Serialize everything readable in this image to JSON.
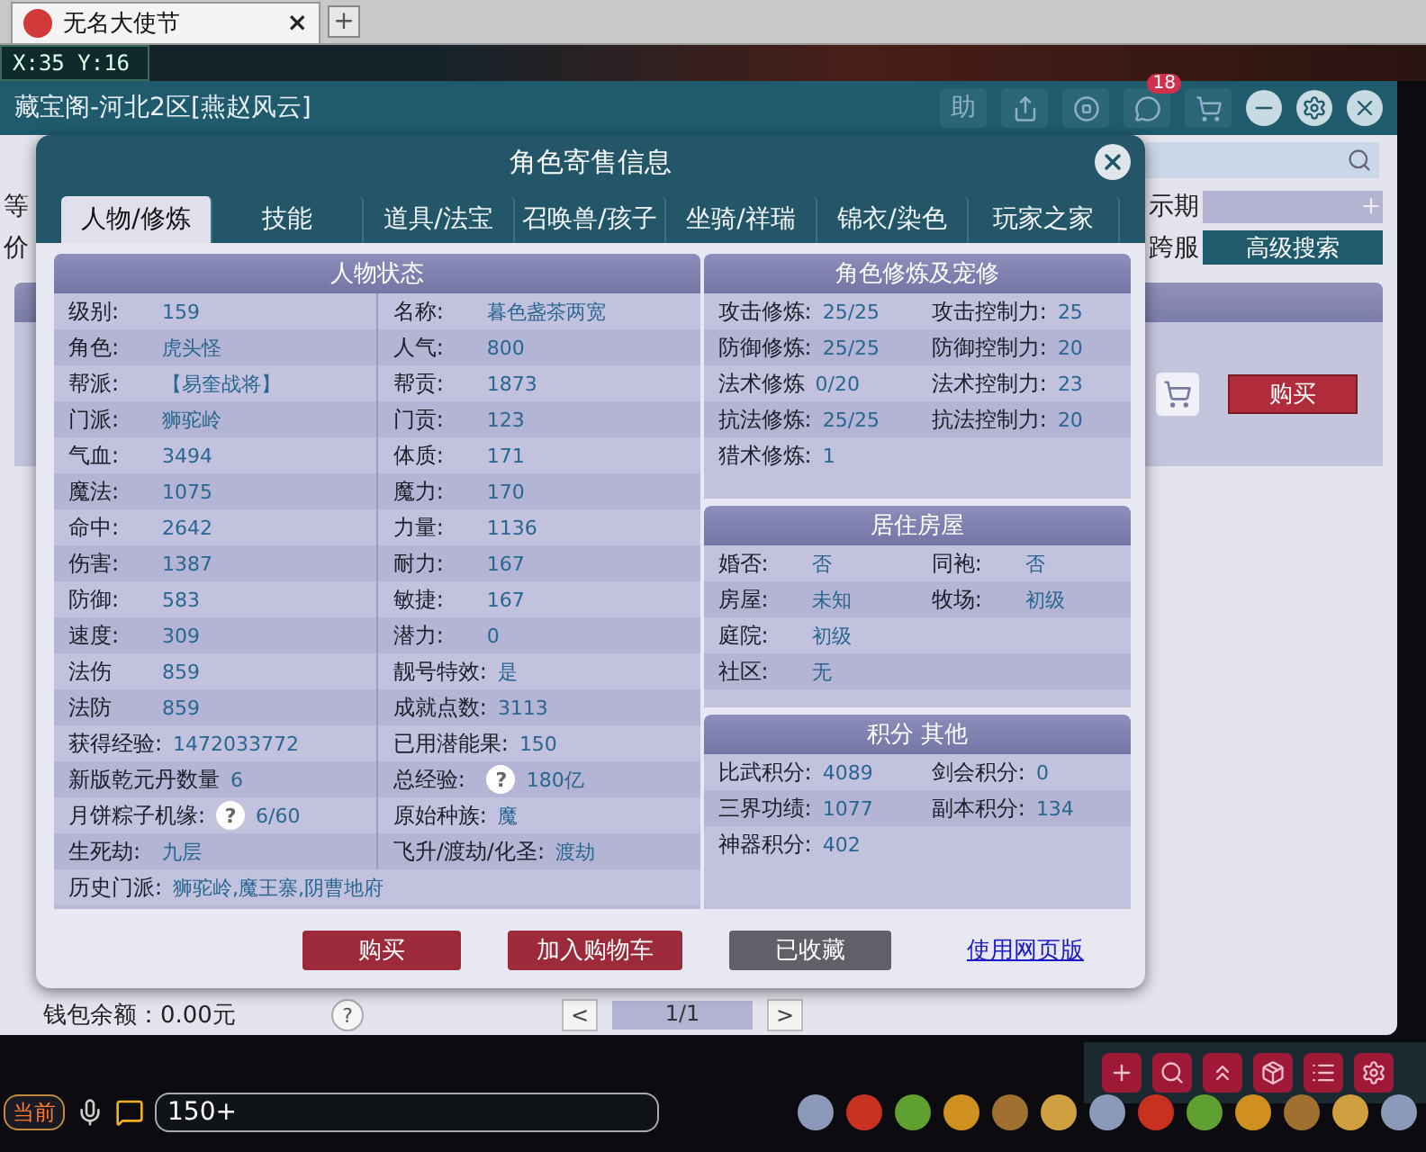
{
  "browser": {
    "tab_title": "无名大使节",
    "tab_close": "×",
    "new_tab": "+"
  },
  "game_hud": {
    "coords": "X:35 Y:16"
  },
  "back_window": {
    "title": "藏宝阁-河北2区[燕赵风云]",
    "help_button": "助",
    "notification_count": "18",
    "left_labels": [
      "等",
      "价"
    ],
    "right_labels": [
      "示期",
      "跨服"
    ],
    "advanced_search": "高级搜索",
    "buy": "购买",
    "wallet": "钱包余额：0.00元",
    "help_mark": "?",
    "pager": {
      "prev": "<",
      "page": "1/1",
      "next": ">"
    }
  },
  "dialog": {
    "title": "角色寄售信息",
    "tabs": [
      {
        "label": "人物/修炼",
        "selected": true
      },
      {
        "label": "技能",
        "selected": false
      },
      {
        "label": "道具/法宝",
        "selected": false
      },
      {
        "label": "召唤兽/孩子",
        "selected": false
      },
      {
        "label": "坐骑/祥瑞",
        "selected": false
      },
      {
        "label": "锦衣/染色",
        "selected": false
      },
      {
        "label": "玩家之家",
        "selected": false
      }
    ],
    "status_panel": {
      "title": "人物状态",
      "rows": [
        [
          {
            "label": "级别:",
            "value": "159"
          },
          {
            "label": "名称:",
            "value": "暮色盏茶两宽"
          }
        ],
        [
          {
            "label": "角色:",
            "value": "虎头怪"
          },
          {
            "label": "人气:",
            "value": "800"
          }
        ],
        [
          {
            "label": "帮派:",
            "value": "【易奎战将】"
          },
          {
            "label": "帮贡:",
            "value": "1873"
          }
        ],
        [
          {
            "label": "门派:",
            "value": "狮驼岭"
          },
          {
            "label": "门贡:",
            "value": "123"
          }
        ],
        [
          {
            "label": "气血:",
            "value": "3494"
          },
          {
            "label": "体质:",
            "value": "171"
          }
        ],
        [
          {
            "label": "魔法:",
            "value": "1075"
          },
          {
            "label": "魔力:",
            "value": "170"
          }
        ],
        [
          {
            "label": "命中:",
            "value": "2642"
          },
          {
            "label": "力量:",
            "value": "1136"
          }
        ],
        [
          {
            "label": "伤害:",
            "value": "1387"
          },
          {
            "label": "耐力:",
            "value": "167"
          }
        ],
        [
          {
            "label": "防御:",
            "value": "583"
          },
          {
            "label": "敏捷:",
            "value": "167"
          }
        ],
        [
          {
            "label": "速度:",
            "value": "309"
          },
          {
            "label": "潜力:",
            "value": "0"
          }
        ],
        [
          {
            "label": "法伤",
            "value": "859"
          },
          {
            "label": "靓号特效:",
            "value": "是"
          }
        ],
        [
          {
            "label": "法防",
            "value": "859"
          },
          {
            "label": "成就点数:",
            "value": "3113"
          }
        ],
        [
          {
            "label": "获得经验:",
            "value": "1472033772"
          },
          {
            "label": "已用潜能果:",
            "value": "150"
          }
        ],
        [
          {
            "label": "新版乾元丹数量",
            "value": "6"
          },
          {
            "label": "总经验:",
            "help": "?",
            "value": "180亿"
          }
        ],
        [
          {
            "label": "月饼粽子机缘:",
            "help": "?",
            "value": "6/60"
          },
          {
            "label": "原始种族:",
            "value": "魔"
          }
        ],
        [
          {
            "label": "生死劫:",
            "value": "九层"
          },
          {
            "label": "飞升/渡劫/化圣:",
            "value": "渡劫"
          }
        ],
        [
          {
            "label": "历史门派:",
            "value": "狮驼岭,魔王寨,阴曹地府"
          }
        ]
      ]
    },
    "side_panels": [
      {
        "title": "角色修炼及宠修",
        "rows": [
          [
            {
              "label": "攻击修炼:",
              "value": "25/25"
            },
            {
              "label": "攻击控制力:",
              "value": "25"
            }
          ],
          [
            {
              "label": "防御修炼:",
              "value": "25/25"
            },
            {
              "label": "防御控制力:",
              "value": "20"
            }
          ],
          [
            {
              "label": "法术修炼",
              "value": "0/20"
            },
            {
              "label": "法术控制力:",
              "value": "23"
            }
          ],
          [
            {
              "label": "抗法修炼:",
              "value": "25/25"
            },
            {
              "label": "抗法控制力:",
              "value": "20"
            }
          ],
          [
            {
              "label": "猎术修炼:",
              "value": "1"
            }
          ]
        ]
      },
      {
        "title": "居住房屋",
        "rows": [
          [
            {
              "label": "婚否:",
              "value": "否"
            },
            {
              "label": "同袍:",
              "value": "否"
            }
          ],
          [
            {
              "label": "房屋:",
              "value": "未知"
            },
            {
              "label": "牧场:",
              "value": "初级"
            }
          ],
          [
            {
              "label": "庭院:",
              "value": "初级"
            }
          ],
          [
            {
              "label": "社区:",
              "value": "无"
            }
          ]
        ]
      },
      {
        "title": "积分 其他",
        "rows": [
          [
            {
              "label": "比武积分:",
              "value": "4089"
            },
            {
              "label": "剑会积分:",
              "value": "0"
            }
          ],
          [
            {
              "label": "三界功绩:",
              "value": "1077"
            },
            {
              "label": "副本积分:",
              "value": "134"
            }
          ],
          [
            {
              "label": "神器积分:",
              "value": "402"
            }
          ]
        ]
      }
    ],
    "actions": [
      {
        "label": "购买",
        "kind": "primary"
      },
      {
        "label": "加入购物车",
        "kind": "primary"
      },
      {
        "label": "已收藏",
        "kind": "muted"
      },
      {
        "label": "使用网页版",
        "kind": "link"
      }
    ]
  },
  "bottom_bar": {
    "channel": "当前",
    "chat_input": "150+"
  }
}
